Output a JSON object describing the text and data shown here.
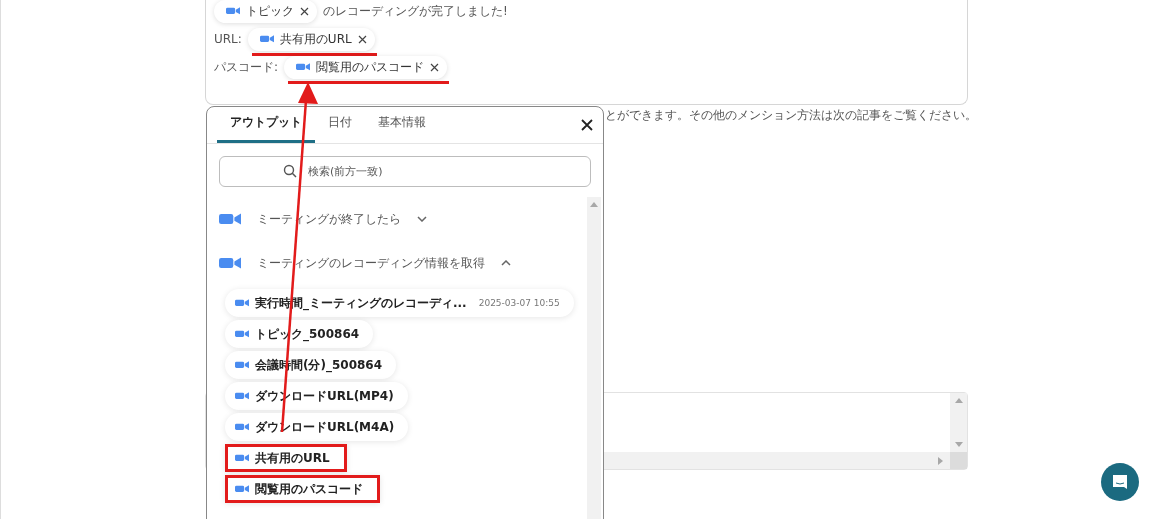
{
  "editor": {
    "lines": [
      {
        "token": {
          "text": "トピック",
          "highlighted": false
        },
        "after": "のレコーディングが完了しました!"
      },
      {
        "label": "URL:",
        "token": {
          "text": "共有用のURL",
          "highlighted": true
        }
      },
      {
        "label": "パスコード:",
        "token": {
          "text": "閲覧用のパスコード",
          "highlighted": true
        }
      }
    ]
  },
  "help_text": "とができます。その他のメンション方法は次の記事をご覧ください。",
  "popup": {
    "tabs": [
      {
        "label": "アウトプット",
        "selected": true
      },
      {
        "label": "日付",
        "selected": false
      },
      {
        "label": "基本情報",
        "selected": false
      }
    ],
    "search": {
      "placeholder": "検索(前方一致)"
    },
    "groups": [
      {
        "title": "ミーティングが終了したら",
        "expanded": false
      },
      {
        "title": "ミーティングのレコーディング情報を取得",
        "expanded": true,
        "items": [
          {
            "label": "実行時間_ミーティングのレコーディ...",
            "value": "2025-03-07 10:55",
            "highlighted": false
          },
          {
            "label": "トピック_500864",
            "highlighted": false
          },
          {
            "label": "会議時間(分)_500864",
            "highlighted": false
          },
          {
            "label": "ダウンロードURL(MP4)",
            "highlighted": false
          },
          {
            "label": "ダウンロードURL(M4A)",
            "highlighted": false
          },
          {
            "label": "共有用のURL",
            "highlighted": true
          },
          {
            "label": "閲覧用のパスコード",
            "highlighted": true
          }
        ]
      }
    ]
  },
  "annotation": {
    "arrow": true
  }
}
